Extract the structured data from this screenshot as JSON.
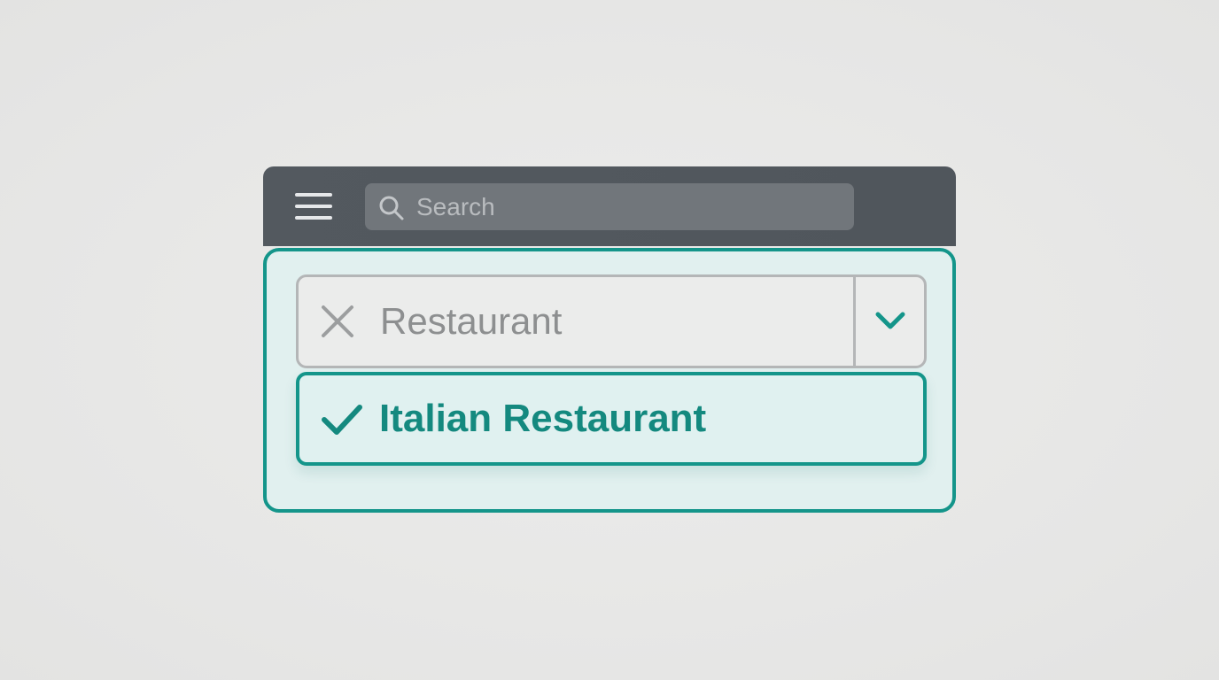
{
  "toolbar": {
    "menu_icon": "hamburger-menu-icon",
    "search": {
      "placeholder": "Search",
      "value": "",
      "icon": "search-icon"
    }
  },
  "combobox": {
    "value": "Restaurant",
    "clear_icon": "close-icon",
    "dropdown_icon": "chevron-down-icon"
  },
  "dropdown": {
    "options": [
      {
        "label": "Italian Restaurant",
        "selected": true,
        "icon": "checkmark-icon"
      }
    ]
  },
  "colors": {
    "accent": "#14958a",
    "toolbar": "#53595f",
    "panel_background": "#e1f0ef",
    "input_border": "#b4b6b7",
    "input_text": "#8d8f90"
  }
}
